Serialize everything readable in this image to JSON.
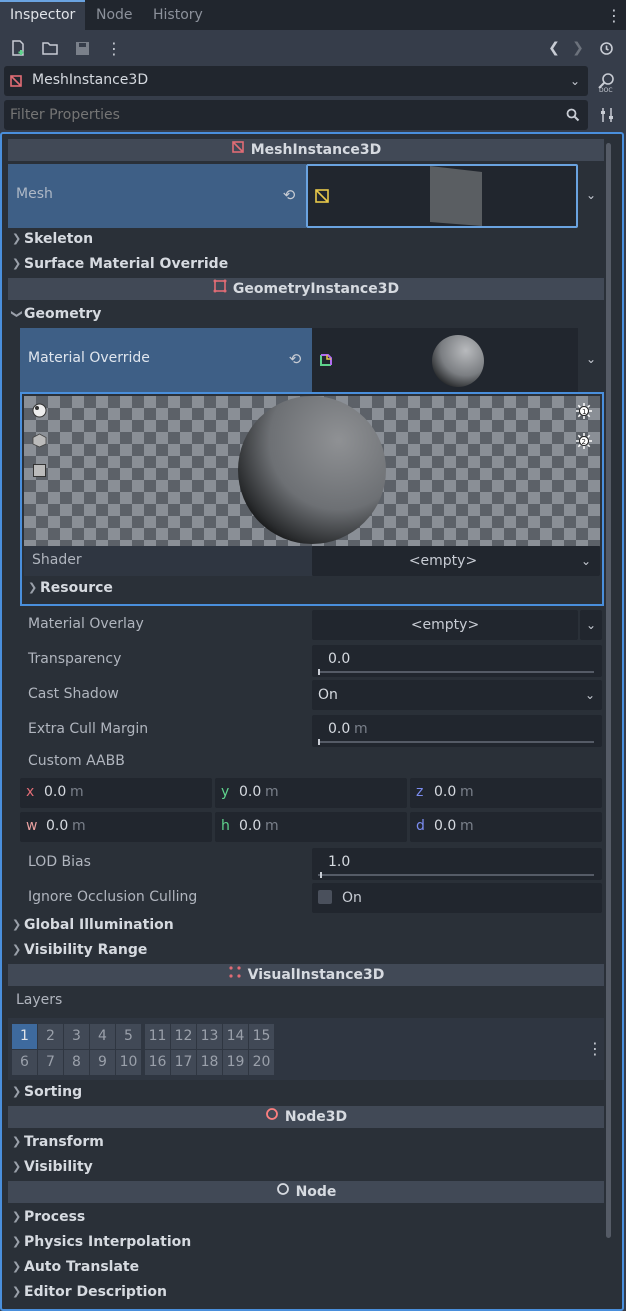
{
  "tabs": [
    "Inspector",
    "Node",
    "History"
  ],
  "object_selector": {
    "label": "MeshInstance3D"
  },
  "filter": {
    "placeholder": "Filter Properties"
  },
  "headers": {
    "meshinstance": "MeshInstance3D",
    "geometryinstance": "GeometryInstance3D",
    "visualinstance": "VisualInstance3D",
    "node3d": "Node3D",
    "node": "Node"
  },
  "props": {
    "mesh": "Mesh",
    "skeleton": "Skeleton",
    "surface_material_override": "Surface Material Override",
    "geometry": "Geometry",
    "material_override": "Material Override",
    "shader": "Shader",
    "shader_value": "<empty>",
    "resource": "Resource",
    "material_overlay": "Material Overlay",
    "material_overlay_value": "<empty>",
    "transparency": "Transparency",
    "transparency_value": "0.0",
    "cast_shadow": "Cast Shadow",
    "cast_shadow_value": "On",
    "extra_cull_margin": "Extra Cull Margin",
    "extra_cull_margin_value": "0.0",
    "unit_m": "m",
    "custom_aabb": "Custom AABB",
    "aabb": {
      "x_label": "x",
      "x": "0.0",
      "y_label": "y",
      "y": "0.0",
      "z_label": "z",
      "z": "0.0",
      "w_label": "w",
      "w": "0.0",
      "h_label": "h",
      "h": "0.0",
      "d_label": "d",
      "d": "0.0"
    },
    "lod_bias": "LOD Bias",
    "lod_bias_value": "1.0",
    "ignore_occlusion": "Ignore Occlusion Culling",
    "ignore_occlusion_value": "On",
    "global_illumination": "Global Illumination",
    "visibility_range": "Visibility Range",
    "layers": "Layers",
    "layer_row1": [
      "1",
      "2",
      "3",
      "4",
      "5",
      "11",
      "12",
      "13",
      "14",
      "15"
    ],
    "layer_row2": [
      "6",
      "7",
      "8",
      "9",
      "10",
      "16",
      "17",
      "18",
      "19",
      "20"
    ],
    "sorting": "Sorting",
    "transform": "Transform",
    "visibility": "Visibility",
    "process": "Process",
    "physics_interpolation": "Physics Interpolation",
    "auto_translate": "Auto Translate",
    "editor_description": "Editor Description"
  },
  "colors": {
    "accent": "#4a8fdc",
    "selected_row": "#3e5f86",
    "mesh_icon": "#e06c75",
    "node3d_icon": "#fc7f7f"
  },
  "transparency_fraction": 0.0,
  "lod_bias_fraction": 0.0
}
